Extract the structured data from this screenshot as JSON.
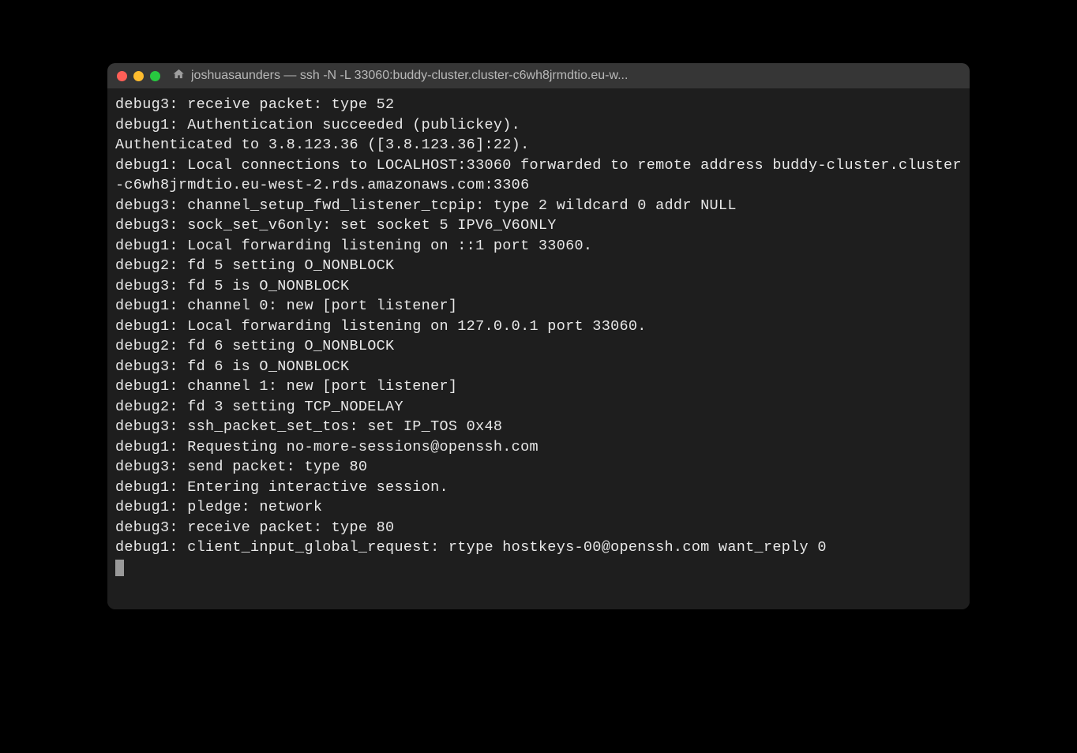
{
  "window": {
    "title": "joshuasaunders — ssh -N -L 33060:buddy-cluster.cluster-c6wh8jrmdtio.eu-w..."
  },
  "terminal": {
    "lines": [
      "debug3: receive packet: type 52",
      "debug1: Authentication succeeded (publickey).",
      "Authenticated to 3.8.123.36 ([3.8.123.36]:22).",
      "debug1: Local connections to LOCALHOST:33060 forwarded to remote address buddy-cluster.cluster-c6wh8jrmdtio.eu-west-2.rds.amazonaws.com:3306",
      "debug3: channel_setup_fwd_listener_tcpip: type 2 wildcard 0 addr NULL",
      "debug3: sock_set_v6only: set socket 5 IPV6_V6ONLY",
      "debug1: Local forwarding listening on ::1 port 33060.",
      "debug2: fd 5 setting O_NONBLOCK",
      "debug3: fd 5 is O_NONBLOCK",
      "debug1: channel 0: new [port listener]",
      "debug1: Local forwarding listening on 127.0.0.1 port 33060.",
      "debug2: fd 6 setting O_NONBLOCK",
      "debug3: fd 6 is O_NONBLOCK",
      "debug1: channel 1: new [port listener]",
      "debug2: fd 3 setting TCP_NODELAY",
      "debug3: ssh_packet_set_tos: set IP_TOS 0x48",
      "debug1: Requesting no-more-sessions@openssh.com",
      "debug3: send packet: type 80",
      "debug1: Entering interactive session.",
      "debug1: pledge: network",
      "debug3: receive packet: type 80",
      "debug1: client_input_global_request: rtype hostkeys-00@openssh.com want_reply 0"
    ]
  }
}
